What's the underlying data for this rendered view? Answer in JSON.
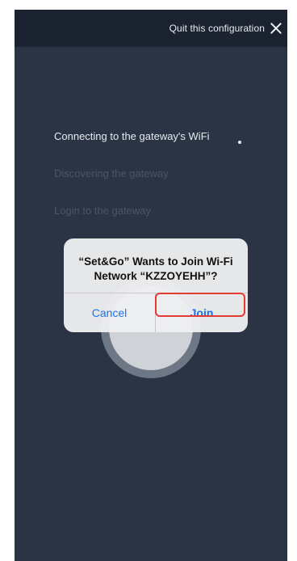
{
  "header": {
    "quit_label": "Quit this configuration",
    "close_icon": "close-icon"
  },
  "steps": [
    {
      "label": "Connecting to the gateway's WiFi",
      "state": "active"
    },
    {
      "label": "Discovering the gateway",
      "state": "pending"
    },
    {
      "label": "Login to the gateway",
      "state": "pending"
    }
  ],
  "alert": {
    "title": "“Set&Go” Wants to Join Wi-Fi Network “KZZOYEHH”?",
    "cancel_label": "Cancel",
    "join_label": "Join"
  },
  "colors": {
    "background": "#2b3444",
    "header": "#1b2230",
    "alert_button": "#1a73e8",
    "highlight": "#e53935"
  }
}
